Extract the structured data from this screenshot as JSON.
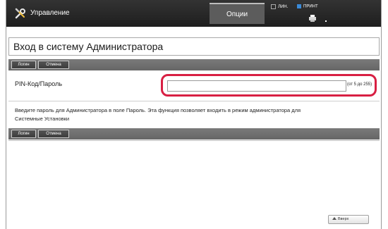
{
  "header": {
    "app_title": "Управление",
    "search_tab": "Опции",
    "line_status": "ЛИН.",
    "print_status": "ПРИНТ",
    "icons": {
      "tools": "wrench-screwdriver-icon",
      "printer": "printer-icon"
    },
    "colors": {
      "bar": "#2a2a2a",
      "print_indicator": "#3a8ad8"
    }
  },
  "page": {
    "title": "Вход в систему Администратора",
    "login_button": "Логин",
    "cancel_button": "Отмена"
  },
  "pin": {
    "label": "PIN-Код/Пароль",
    "value": "",
    "hint": "(от 5 до 255)",
    "highlight_color": "#d81f43"
  },
  "info": {
    "line1": "Введите пароль для Администратора в поле Пароль. Эта функция позволяет входить в режим администратора для",
    "line2": "Системные Установки"
  },
  "footer": {
    "back_to_top": "Вверх"
  }
}
